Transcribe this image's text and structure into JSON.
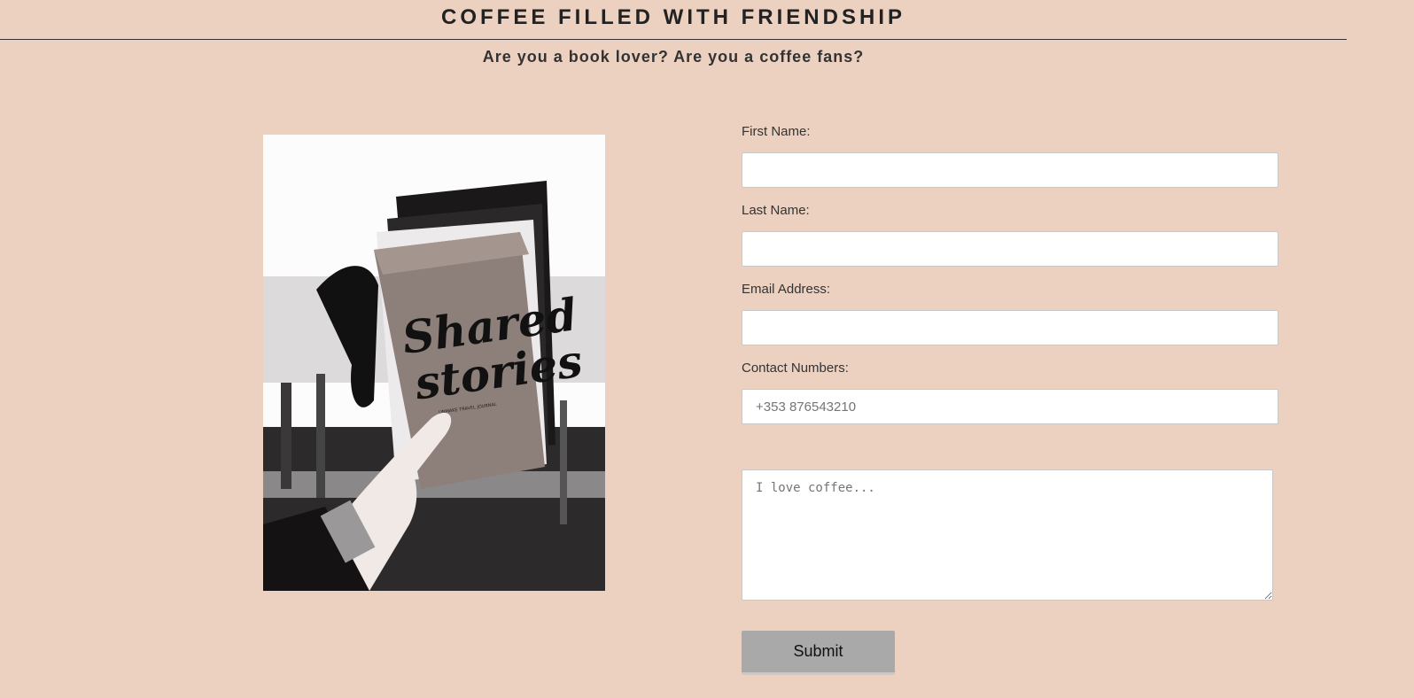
{
  "header": {
    "title": "COFFEE FILLED WITH FRIENDSHIP",
    "tagline": "Are you a book lover? Are you a coffee fans?"
  },
  "image": {
    "script_title_line1": "Shared",
    "script_title_line2": "stories",
    "subtitle": "UNMAKE TRAVEL JOURNAL"
  },
  "form": {
    "first_name_label": "First Name:",
    "first_name_value": "",
    "last_name_label": "Last Name:",
    "last_name_value": "",
    "email_label": "Email Address:",
    "email_value": "",
    "contact_label": "Contact Numbers:",
    "contact_placeholder": "+353 876543210",
    "message_placeholder": "I love coffee...",
    "submit_label": "Submit"
  },
  "colors": {
    "background": "#ecd1c0",
    "input_background": "#ffffff",
    "button": "#a9a9a9"
  }
}
